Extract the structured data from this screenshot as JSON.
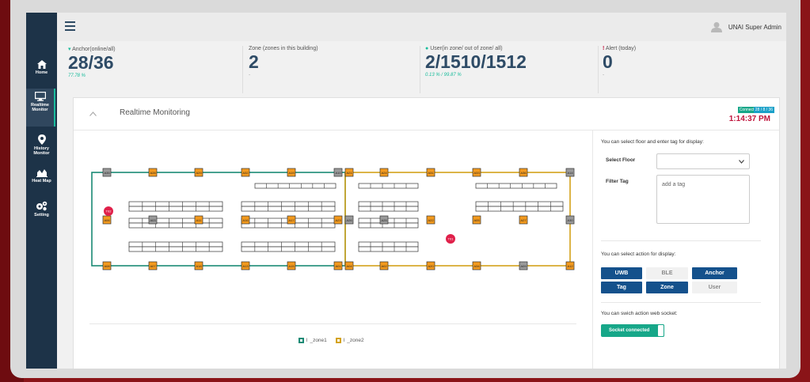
{
  "user": {
    "name": "UNAI Super Admin"
  },
  "sidebar": {
    "items": [
      {
        "label": "Home",
        "icon": "home-icon"
      },
      {
        "label": "Realtime Monitor",
        "icon": "monitor-icon"
      },
      {
        "label": "History Monitor",
        "icon": "location-pin-icon"
      },
      {
        "label": "Heat Map",
        "icon": "area-chart-icon"
      },
      {
        "label": "Setting",
        "icon": "gears-icon"
      }
    ]
  },
  "stats": [
    {
      "label": "Anchor(online/all)",
      "icon": "wifi-icon",
      "value": "28/36",
      "sub": "77.78 %"
    },
    {
      "label": "Zone (zones in this building)",
      "icon": "",
      "value": "2",
      "sub": "-"
    },
    {
      "label": "User(in zone/ out of zone/ all)",
      "icon": "user-icon",
      "value": "2/1510/1512",
      "sub": "0.13 % / 99.87 %"
    },
    {
      "label": "Alert (today)",
      "icon": "exclamation-icon",
      "value": "0",
      "sub": "-"
    }
  ],
  "panel": {
    "title": "Realtime Monitoring",
    "status": "Connected",
    "counts": "28 / 8 / 36",
    "time": "1:14:37 PM"
  },
  "controls": {
    "floor_hint": "You can select floor and enter tag for display:",
    "select_floor_label": "Select Floor",
    "filter_tag_label": "Filter Tag",
    "tag_placeholder": "add a tag",
    "action_hint": "You can select action for display:",
    "actions": [
      "UWB",
      "BLE",
      "Anchor",
      "Tag",
      "Zone",
      "User"
    ],
    "actions_active": [
      true,
      false,
      true,
      true,
      true,
      false
    ],
    "socket_hint": "You can swich action web socket:",
    "socket_label": "Socket connected"
  },
  "legend": [
    {
      "label": "_zone1",
      "color": "#1a8a75"
    },
    {
      "label": "_zone2",
      "color": "#d4a21a"
    }
  ],
  "map": {
    "anchors": [
      "A35",
      "A28",
      "A29",
      "A32",
      "A19",
      "A10",
      "A21",
      "A24",
      "A31",
      "A33",
      "A36",
      "A14",
      "A06",
      "A03",
      "A11",
      "A16",
      "A17",
      "A23",
      "A26",
      "A25",
      "A22",
      "A05",
      "A27",
      "A30",
      "A08",
      "A07",
      "A18",
      "A13",
      "A15",
      "A01",
      "A04",
      "A02",
      "A20",
      "A34",
      "A09",
      "A12"
    ],
    "tags": [
      "T02",
      "T01"
    ]
  }
}
